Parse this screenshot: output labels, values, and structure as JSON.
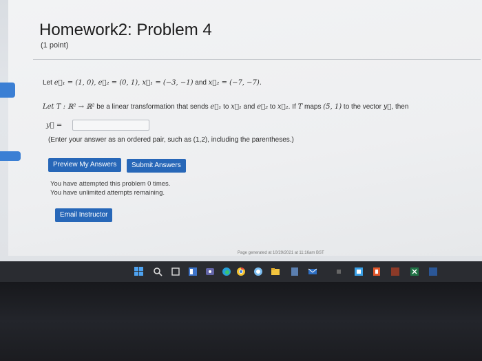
{
  "problem": {
    "title": "Homework2: Problem 4",
    "points": "(1 point)",
    "vectors_line": {
      "let": "Let",
      "e1": "e⃗₁ = (1, 0), ",
      "e2": "e⃗₂ = (0, 1), ",
      "x1": "x⃗₁ = (−3, −1)",
      "and": " and ",
      "x2": "x⃗₂ = (−7, −7)."
    },
    "transform_line": {
      "let_T": "Let T : ℝ² → ℝ²",
      "text1": " be a linear transformation that sends ",
      "e1": "e⃗₁",
      "to1": " to ",
      "x1": "x⃗₁",
      "and": " and ",
      "e2": "e⃗₂",
      "to2": " to ",
      "x2": "x⃗₂",
      "text2": ". If ",
      "T": "T",
      "maps": " maps ",
      "point": "(5, 1)",
      "text3": " to the vector ",
      "y": "y⃗",
      "then": ", then"
    },
    "answer_label": "y⃗ =",
    "answer_value": "",
    "hint": "(Enter your answer as an ordered pair, such as (1,2), including the parentheses.)"
  },
  "buttons": {
    "preview": "Preview My Answers",
    "submit": "Submit Answers",
    "email": "Email Instructor"
  },
  "attempts": {
    "line1": "You have attempted this problem 0 times.",
    "line2": "You have unlimited attempts remaining."
  },
  "footer": "Page generated at 10/29/2021 at 11:16am BST",
  "colors": {
    "button_blue": "#2767b8",
    "taskbar": "#2a2c31"
  }
}
